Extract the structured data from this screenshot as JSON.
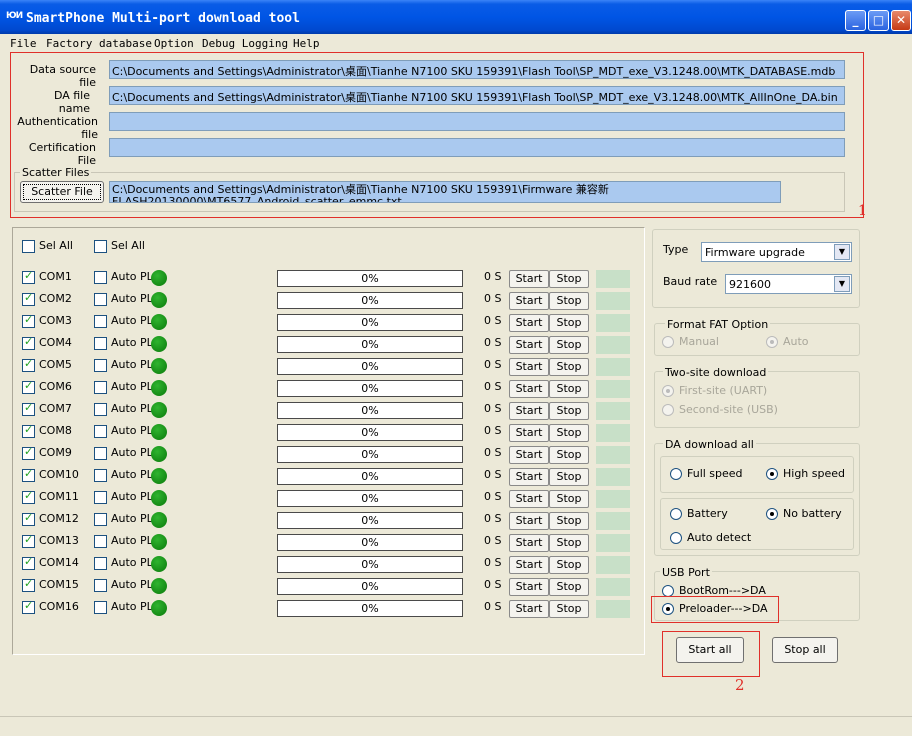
{
  "window": {
    "icon_text": "ЮИ",
    "title": "SmartPhone Multi-port download tool",
    "minimize": "_",
    "maximize": "□",
    "close": "✕"
  },
  "menu": [
    "File",
    "Factory database",
    "Option",
    "Debug Logging",
    "Help"
  ],
  "files": {
    "data_source_label": "Data source file",
    "data_source_value": "C:\\Documents and Settings\\Administrator\\桌面\\Tianhe N7100 SKU 159391\\Flash Tool\\SP_MDT_exe_V3.1248.00\\MTK_DATABASE.mdb",
    "da_label": "DA file name",
    "da_value": "C:\\Documents and Settings\\Administrator\\桌面\\Tianhe N7100 SKU 159391\\Flash Tool\\SP_MDT_exe_V3.1248.00\\MTK_AllInOne_DA.bin",
    "auth_label": "Authentication file",
    "auth_value": "",
    "cert_label": "Certification File",
    "cert_value": "",
    "scatter_caption": "Scatter Files",
    "scatter_button": "Scatter File",
    "scatter_value_line1": "C:\\Documents and Settings\\Administrator\\桌面\\Tianhe N7100 SKU 159391\\Firmware 兼容新",
    "scatter_value_line2": "FLASH20130000\\MT6577_Android_scatter_emmc.txt"
  },
  "annotation_marks": [
    "1",
    "2"
  ],
  "com_panel": {
    "sel_all_1": "Sel All",
    "sel_all_2": "Sel All",
    "auto_label": "Auto PL",
    "start_label": "Start",
    "stop_label": "Stop",
    "ports": [
      {
        "name": "COM1",
        "progress": "0%",
        "time": "0 S"
      },
      {
        "name": "COM2",
        "progress": "0%",
        "time": "0 S"
      },
      {
        "name": "COM3",
        "progress": "0%",
        "time": "0 S"
      },
      {
        "name": "COM4",
        "progress": "0%",
        "time": "0 S"
      },
      {
        "name": "COM5",
        "progress": "0%",
        "time": "0 S"
      },
      {
        "name": "COM6",
        "progress": "0%",
        "time": "0 S"
      },
      {
        "name": "COM7",
        "progress": "0%",
        "time": "0 S"
      },
      {
        "name": "COM8",
        "progress": "0%",
        "time": "0 S"
      },
      {
        "name": "COM9",
        "progress": "0%",
        "time": "0 S"
      },
      {
        "name": "COM10",
        "progress": "0%",
        "time": "0 S"
      },
      {
        "name": "COM11",
        "progress": "0%",
        "time": "0 S"
      },
      {
        "name": "COM12",
        "progress": "0%",
        "time": "0 S"
      },
      {
        "name": "COM13",
        "progress": "0%",
        "time": "0 S"
      },
      {
        "name": "COM14",
        "progress": "0%",
        "time": "0 S"
      },
      {
        "name": "COM15",
        "progress": "0%",
        "time": "0 S"
      },
      {
        "name": "COM16",
        "progress": "0%",
        "time": "0 S"
      }
    ]
  },
  "settings": {
    "type_label": "Type",
    "type_value": "Firmware upgrade",
    "baud_label": "Baud rate",
    "baud_value": "921600",
    "format_fat_caption": "Format FAT Option",
    "format_manual": "Manual",
    "format_auto": "Auto",
    "two_site_caption": "Two-site download",
    "first_site": "First-site (UART)",
    "second_site": "Second-site (USB)",
    "da_download_caption": "DA download all",
    "full_speed": "Full speed",
    "high_speed": "High speed",
    "battery": "Battery",
    "no_battery": "No battery",
    "auto_detect": "Auto detect",
    "usb_port_caption": "USB Port",
    "bootrom_da": "BootRom--->DA",
    "preloader_da": "Preloader--->DA",
    "start_all": "Start all",
    "stop_all": "Stop all"
  },
  "colors": {
    "title_bar": "#0055e5",
    "field_bg": "#aac9ef",
    "led_green": "#1a9a1a",
    "annotation_red": "#e0302a"
  }
}
